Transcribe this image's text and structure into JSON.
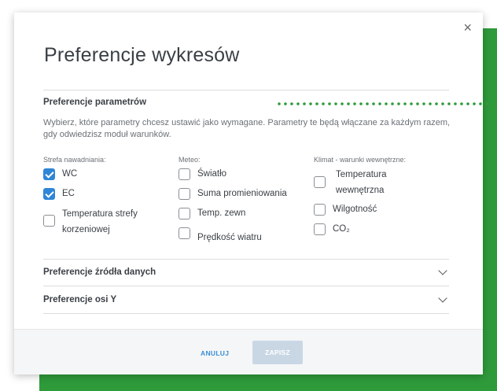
{
  "dialog": {
    "title": "Preferencje wykresów",
    "close_symbol": "×"
  },
  "sections": {
    "parameters": {
      "heading": "Preferencje parametrów",
      "description": "Wybierz, które parametry chcesz ustawić jako wymagane. Parametry te będą włączane za każdym razem, gdy odwiedzisz moduł warunków.",
      "columns": [
        {
          "heading": "Strefa nawadniania:",
          "options": [
            {
              "label": "WC",
              "checked": true
            },
            {
              "label": "EC",
              "checked": true
            },
            {
              "label": "Temperatura strefy korzeniowej",
              "checked": false
            }
          ]
        },
        {
          "heading": "Meteo:",
          "options": [
            {
              "label": "Światło",
              "checked": false
            },
            {
              "label": "Suma promieniowania",
              "checked": false
            },
            {
              "label": "Temp. zewn",
              "checked": false
            },
            {
              "label": "Prędkość wiatru",
              "checked": false
            }
          ]
        },
        {
          "heading": "Klimat - warunki wewnętrzne:",
          "options": [
            {
              "label": "Temperatura wewnętrzna",
              "checked": false
            },
            {
              "label": "Wilgotność",
              "checked": false
            },
            {
              "label": "CO₂",
              "checked": false
            }
          ]
        }
      ]
    },
    "data_source": {
      "heading": "Preferencje źródła danych"
    },
    "y_axis": {
      "heading": "Preferencje osi Y"
    }
  },
  "footer": {
    "cancel_label": "ANULUJ",
    "save_label": "ZAPISZ"
  },
  "colors": {
    "accent": "#2f86d6",
    "background_green": "#2e9a3a",
    "dots_green": "#2e9a3a",
    "save_disabled": "#c9d7e5"
  },
  "icons": {
    "close": "close-icon",
    "collapse": "chevron-down-icon",
    "checkbox": "checkmark-icon"
  }
}
